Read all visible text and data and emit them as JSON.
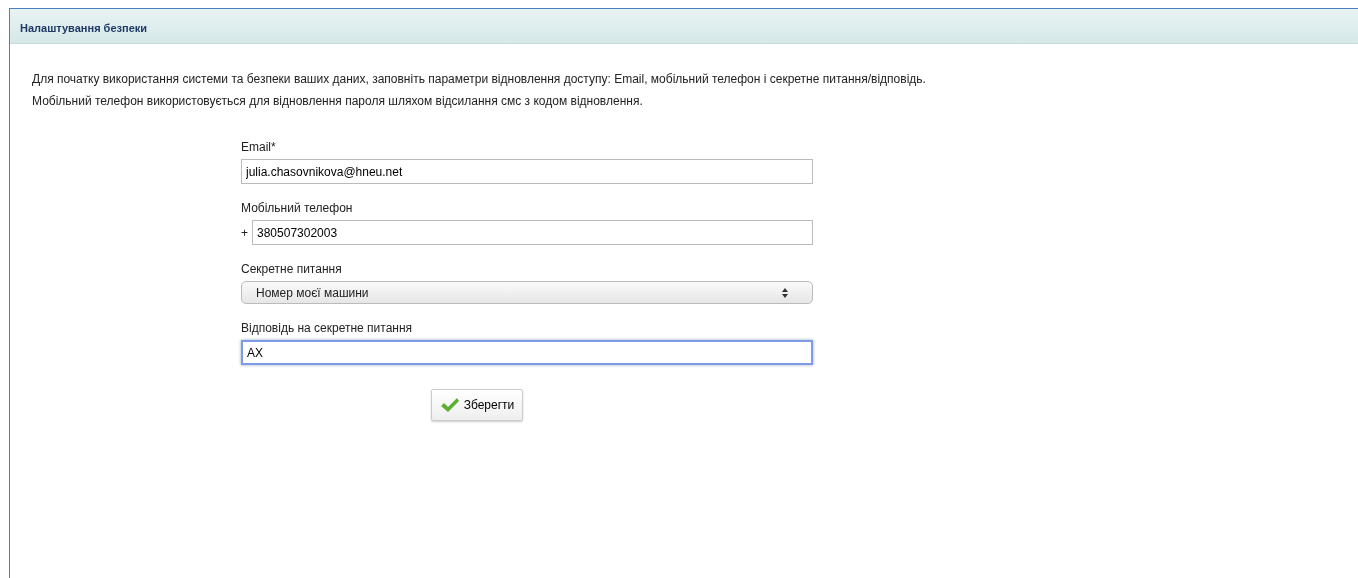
{
  "panel": {
    "title": "Налаштування безпеки"
  },
  "intro": [
    "Для початку використання системи та безпеки ваших даних, заповніть параметри відновлення доступу: Email, мобільний телефон і секретне питання/відповідь.",
    "Мобільний телефон використовується для відновлення пароля шляхом відсилання смс з кодом відновлення."
  ],
  "fields": [
    {
      "kind": "text",
      "label": "Email*",
      "value": "julia.chasovnikova@hneu.net",
      "focused": false
    },
    {
      "kind": "phone",
      "label": "Мобільний телефон",
      "prefix": "+",
      "value": "380507302003",
      "focused": false
    },
    {
      "kind": "select",
      "label": "Секретне питання",
      "value": "Номер моєї машини",
      "focused": false
    },
    {
      "kind": "text",
      "label": "Відповідь на секретне питання",
      "value": "AX",
      "focused": true
    }
  ],
  "save_button": {
    "label": "Зберегти"
  }
}
